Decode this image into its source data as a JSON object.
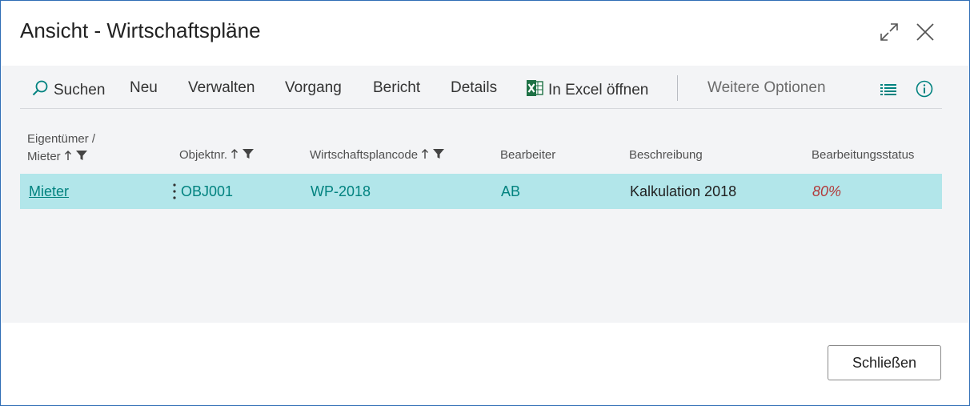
{
  "window": {
    "title": "Ansicht - Wirtschaftspläne"
  },
  "toolbar": {
    "search_label": "Suchen",
    "new_label": "Neu",
    "manage_label": "Verwalten",
    "process_label": "Vorgang",
    "report_label": "Bericht",
    "details_label": "Details",
    "excel_label": "In Excel öffnen",
    "more_label": "Weitere Optionen"
  },
  "table": {
    "columns": {
      "owner_line1": "Eigentümer /",
      "owner_line2": "Mieter",
      "object": "Objektnr.",
      "plan_code": "Wirtschaftsplancode",
      "editor": "Bearbeiter",
      "description": "Beschreibung",
      "status": "Bearbeitungsstatus"
    },
    "rows": [
      {
        "owner": "Mieter",
        "object": "OBJ001",
        "plan_code": "WP-2018",
        "editor": "AB",
        "description": "Kalkulation 2018",
        "status": "80%"
      }
    ]
  },
  "footer": {
    "close_label": "Schließen"
  },
  "colors": {
    "accent": "#00827f",
    "selected_row": "#b2e6ea",
    "status_text": "#b23a3a",
    "excel": "#1e7145"
  }
}
